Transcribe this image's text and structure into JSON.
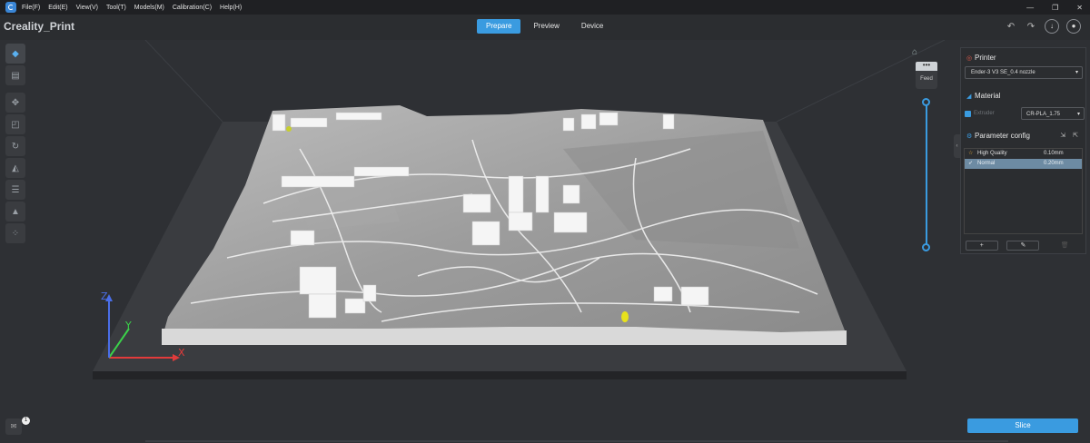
{
  "menu": {
    "items": [
      "File(F)",
      "Edit(E)",
      "View(V)",
      "Tool(T)",
      "Models(M)",
      "Calibration(C)",
      "Help(H)"
    ],
    "window_controls": [
      "—",
      "❐",
      "✕"
    ]
  },
  "header": {
    "app_title": "Creality_Print",
    "tabs": [
      {
        "label": "Prepare",
        "active": true
      },
      {
        "label": "Preview",
        "active": false
      },
      {
        "label": "Device",
        "active": false
      }
    ],
    "icons": [
      "undo-icon",
      "redo-icon",
      "download-icon",
      "user-icon"
    ]
  },
  "left_toolbar": {
    "icons": [
      "cube-icon",
      "folder-icon",
      "move-icon",
      "scale-icon",
      "rotate-icon",
      "paint-icon",
      "layers-icon",
      "support-icon",
      "arrange-icon"
    ]
  },
  "layer_slider": {
    "feed_label": "Feed",
    "feed_dots": "•••"
  },
  "panel": {
    "printer_title": "Printer",
    "printer_value": "Ender-3 V3 SE_0.4 nozzle",
    "material_title": "Material",
    "extruder_label": "Extruder",
    "material_value": "CR-PLA_1.75",
    "param_title": "Parameter config",
    "qualities": [
      {
        "name": "High Quality",
        "value": "0.10mm",
        "selected": false
      },
      {
        "name": "Normal",
        "value": "0.20mm",
        "selected": true
      }
    ],
    "footer_buttons": [
      "+",
      "✎",
      "🗑"
    ]
  },
  "bottom": {
    "slice_label": "Slice",
    "notification_count": "1"
  },
  "colors": {
    "accent": "#3a9be0",
    "background": "#2b2d30",
    "selected_row": "#6d8ba3",
    "axis_x": "#e23b3b",
    "axis_y": "#3bd14a",
    "axis_z": "#4a6ee8"
  },
  "axes": {
    "x": "X",
    "y": "Y",
    "z": "Z"
  }
}
